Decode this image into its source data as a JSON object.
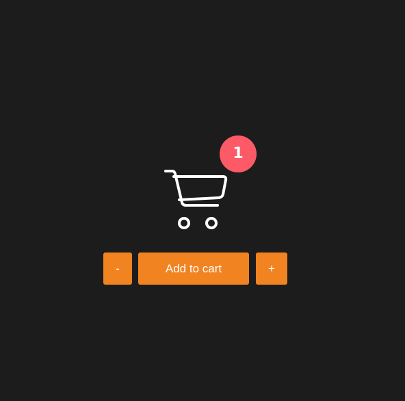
{
  "cart": {
    "icon": "shopping-cart-icon",
    "count": "1"
  },
  "controls": {
    "decrement_label": "-",
    "add_label": "Add to cart",
    "increment_label": "+"
  },
  "colors": {
    "background": "#1c1c1c",
    "badge": "#fc5a67",
    "button": "#f28321",
    "icon": "#ffffff"
  }
}
